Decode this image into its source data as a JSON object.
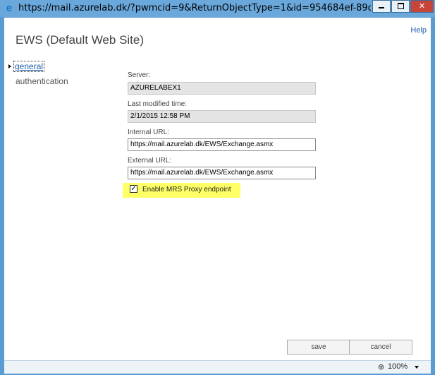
{
  "window": {
    "title": "https://mail.azurelab.dk/?pwmcid=9&ReturnObjectType=1&id=954684ef-89dc-459d-a..."
  },
  "header": {
    "help_label": "Help",
    "page_title": "EWS (Default Web Site)"
  },
  "nav": {
    "items": [
      {
        "label": "general",
        "selected": true
      },
      {
        "label": "authentication",
        "selected": false
      }
    ]
  },
  "form": {
    "server": {
      "label": "Server:",
      "value": "AZURELABEX1"
    },
    "last_modified": {
      "label": "Last modified time:",
      "value": "2/1/2015 12:58 PM"
    },
    "internal_url": {
      "label": "Internal URL:",
      "value": "https://mail.azurelab.dk/EWS/Exchange.asmx"
    },
    "external_url": {
      "label": "External URL:",
      "value": "https://mail.azurelab.dk/EWS/Exchange.asmx"
    },
    "mrs_proxy": {
      "label": "Enable MRS Proxy endpoint",
      "checked": true,
      "highlight_color": "#ffff66"
    }
  },
  "buttons": {
    "save_label": "save",
    "cancel_label": "cancel"
  },
  "statusbar": {
    "zoom": "100%"
  },
  "colors": {
    "frame": "#5a9bd3",
    "link": "#1f5fa8",
    "close_button": "#c7443a"
  },
  "icons": {
    "browser": "ie-icon",
    "minimize": "minimize-icon",
    "maximize": "maximize-icon",
    "close": "close-icon",
    "zoom": "zoom-icon"
  }
}
